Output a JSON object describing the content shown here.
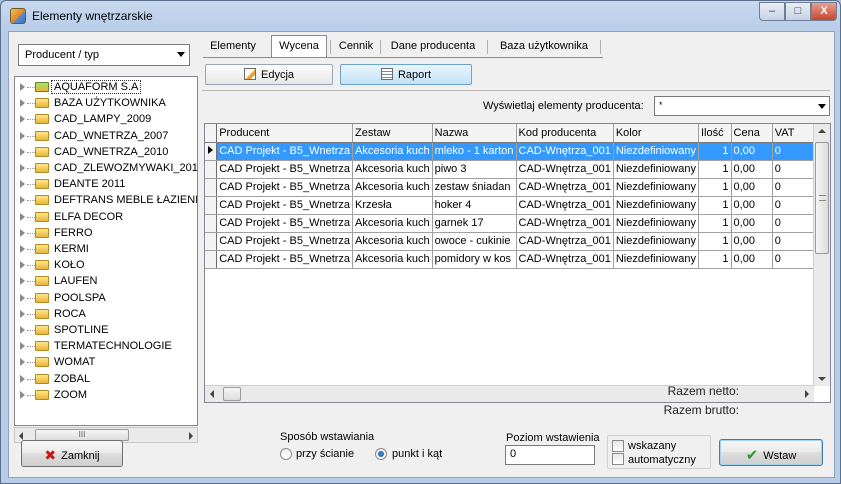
{
  "window": {
    "title": "Elementy wnętrzarskie",
    "min_label": "–",
    "max_label": "□",
    "close_label": "X"
  },
  "left": {
    "filter_combo": "Producent / typ",
    "tree_items": [
      {
        "label": "AQUAFORM S.A"
      },
      {
        "label": "BAZA UŻYTKOWNIKA"
      },
      {
        "label": "CAD_LAMPY_2009"
      },
      {
        "label": "CAD_WNETRZA_2007"
      },
      {
        "label": "CAD_WNETRZA_2010"
      },
      {
        "label": "CAD_ZLEWOZMYWAKI_201"
      },
      {
        "label": "DEANTE 2011"
      },
      {
        "label": "DEFTRANS MEBLE ŁAZIENK"
      },
      {
        "label": "ELFA DECOR"
      },
      {
        "label": "FERRO"
      },
      {
        "label": "KERMI"
      },
      {
        "label": "KOŁO"
      },
      {
        "label": "LAUFEN"
      },
      {
        "label": "POOLSPA"
      },
      {
        "label": "ROCA"
      },
      {
        "label": "SPOTLINE"
      },
      {
        "label": "TERMATECHNOLOGIE"
      },
      {
        "label": "WOMAT"
      },
      {
        "label": "ZOBAL"
      },
      {
        "label": "ZOOM"
      }
    ],
    "hscroll_grip": "III"
  },
  "tabs": [
    "Elementy",
    "Wycena",
    "Cennik",
    "Dane producenta",
    "Baza użytkownika"
  ],
  "active_tab": "Wycena",
  "toolbar": {
    "edit_label": "Edycja",
    "report_label": "Raport"
  },
  "producer_filter": {
    "label": "Wyświetlaj elementy producenta:",
    "value": "*"
  },
  "grid": {
    "columns": [
      "Producent",
      "Zestaw",
      "Nazwa",
      "Kod producenta",
      "Kolor",
      "Ilość",
      "Cena",
      "VAT"
    ],
    "rows": [
      [
        "CAD Projekt - B5_Wnetrza",
        "Akcesoria kuch",
        "mleko - 1 karton",
        "CAD-Wnętrza_001",
        "Niezdefiniowany",
        "1",
        "0,00",
        "0"
      ],
      [
        "CAD Projekt - B5_Wnetrza",
        "Akcesoria kuch",
        "piwo 3",
        "CAD-Wnętrza_001",
        "Niezdefiniowany",
        "1",
        "0,00",
        "0"
      ],
      [
        "CAD Projekt - B5_Wnetrza",
        "Akcesoria kuch",
        "zestaw śniadan",
        "CAD-Wnętrza_001",
        "Niezdefiniowany",
        "1",
        "0,00",
        "0"
      ],
      [
        "CAD Projekt - B5_Wnetrza",
        "Krzesła",
        "hoker 4",
        "CAD-Wnętrza_001",
        "Niezdefiniowany",
        "1",
        "0,00",
        "0"
      ],
      [
        "CAD Projekt - B5_Wnetrza",
        "Akcesoria kuch",
        "garnek 17",
        "CAD-Wnętrza_001",
        "Niezdefiniowany",
        "1",
        "0,00",
        "0"
      ],
      [
        "CAD Projekt - B5_Wnetrza",
        "Akcesoria kuch",
        "owoce - cukinie",
        "CAD-Wnętrza_001",
        "Niezdefiniowany",
        "1",
        "0,00",
        "0"
      ],
      [
        "CAD Projekt - B5_Wnetrza",
        "Akcesoria kuch",
        "pomidory w kos",
        "CAD-Wnętrza_001",
        "Niezdefiniowany",
        "1",
        "0,00",
        "0"
      ]
    ],
    "selected_row": 0
  },
  "totals": {
    "net_label": "Razem netto:",
    "gross_label": "Razem brutto:"
  },
  "bottom": {
    "close_button": "Zamknij",
    "insert_mode": {
      "label": "Sposób wstawiania",
      "option_wall": "przy ścianie",
      "option_point": "punkt i kąt",
      "selected": "punkt i kąt"
    },
    "insert_level": {
      "label": "Poziom wstawienia",
      "value": "0"
    },
    "checkbox_indicated": "wskazany",
    "checkbox_auto": "automatyczny",
    "insert_button": "Wstaw"
  }
}
